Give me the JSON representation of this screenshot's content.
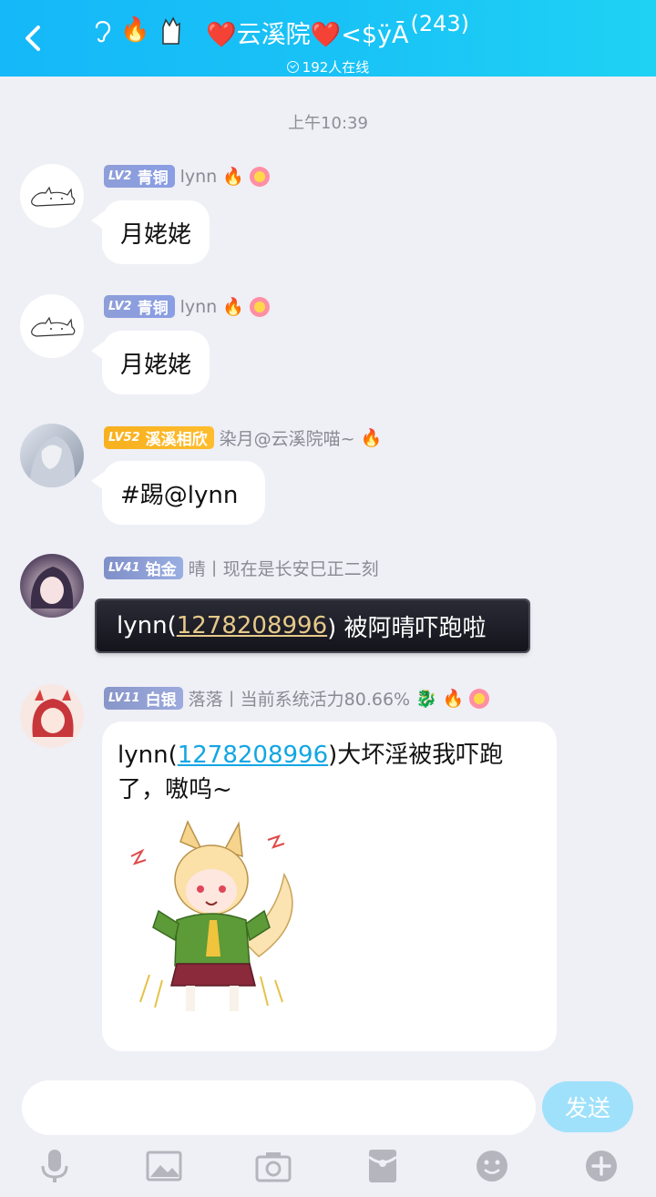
{
  "header": {
    "title": "❤️云溪院❤️<$ÿĀ",
    "member_count": "(243)",
    "online": "192人在线"
  },
  "timestamp": "上午10:39",
  "messages": [
    {
      "badge_lv": "LV2",
      "badge_name": "青铜",
      "sender": "lynn",
      "text": "月姥姥"
    },
    {
      "badge_lv": "LV2",
      "badge_name": "青铜",
      "sender": "lynn",
      "text": "月姥姥"
    },
    {
      "badge_lv": "LV52",
      "badge_name": "溪溪相欣",
      "sender": "染月@云溪院喵~",
      "text": "#踢@lynn"
    },
    {
      "badge_lv": "LV41",
      "badge_name": "铂金",
      "sender": "晴丨现在是长安巳正二刻",
      "text_pre": "lynn(",
      "text_link": "1278208996",
      "text_post": ") 被阿晴吓跑啦"
    },
    {
      "badge_lv": "LV11",
      "badge_name": "白银",
      "sender": "落落丨当前系统活力80.66%",
      "text_pre": "lynn(",
      "text_link": "1278208996",
      "text_post": ")大坏淫被我吓跑了，嗷呜~"
    }
  ],
  "input": {
    "placeholder": "",
    "send_label": "发送"
  },
  "toolbar": [
    "microphone-icon",
    "image-icon",
    "camera-icon",
    "red-packet-icon",
    "emoji-icon",
    "plus-icon"
  ],
  "colors": {
    "header": "#19c3f6",
    "link": "#12a6e3",
    "send": "#9fe1fb",
    "background": "#efeff6"
  }
}
